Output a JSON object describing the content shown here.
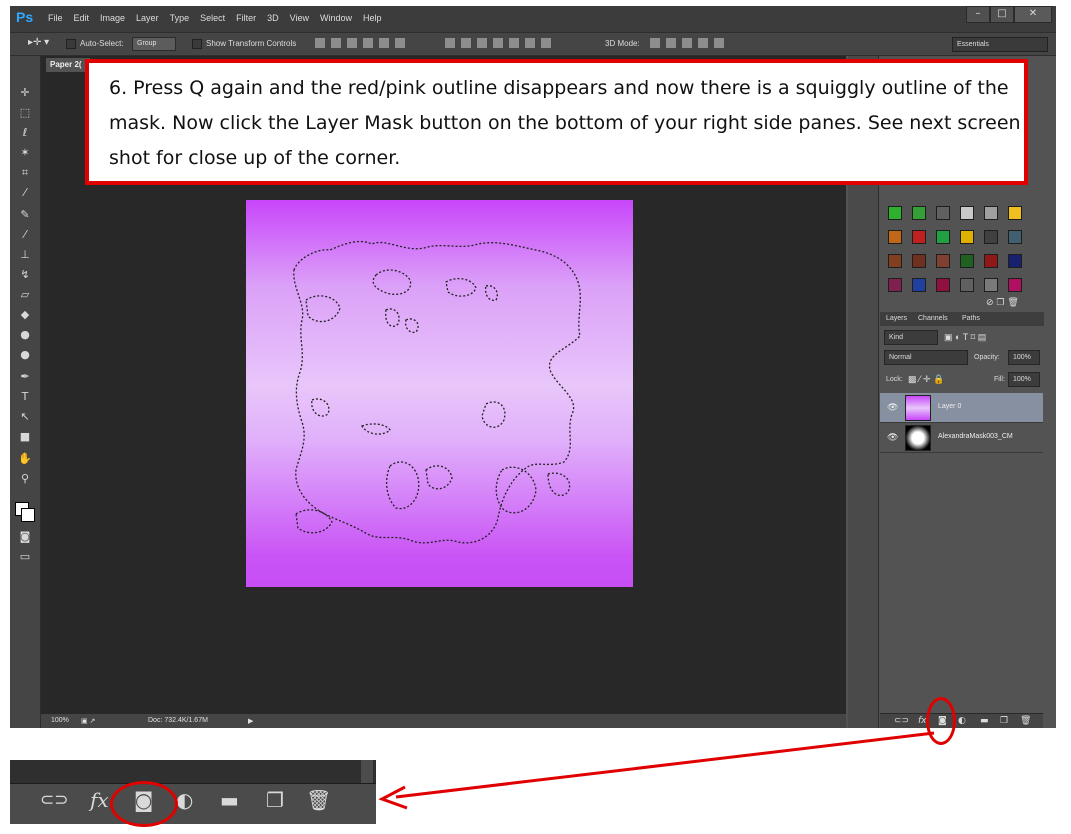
{
  "app": {
    "logo": "Ps",
    "menus": [
      "File",
      "Edit",
      "Image",
      "Layer",
      "Type",
      "Select",
      "Filter",
      "3D",
      "View",
      "Window",
      "Help"
    ],
    "window_buttons": [
      "–",
      "□",
      "✕"
    ]
  },
  "options_bar": {
    "auto_select_label": "Auto-Select:",
    "auto_select_value": "Group",
    "show_transform_label": "Show Transform Controls",
    "mode_3d_label": "3D Mode:",
    "workspace": "Essentials"
  },
  "document": {
    "tab_label": "Paper 2(",
    "zoom": "100%",
    "doc_size": "Doc: 732.4K/1.67M"
  },
  "layers_panel": {
    "tabs": [
      "Layers",
      "Channels",
      "Paths"
    ],
    "filter_kind": "Kind",
    "blend_mode": "Normal",
    "opacity_label": "Opacity:",
    "opacity_value": "100%",
    "lock_label": "Lock:",
    "fill_label": "Fill:",
    "fill_value": "100%",
    "layers": [
      {
        "name": "Layer 0",
        "selected": true
      },
      {
        "name": "AlexandraMask003_CM",
        "selected": false
      }
    ]
  },
  "instruction": {
    "text": "6.  Press Q again and the red/pink outline disappears and now there is a squiggly outline of the mask.  Now click the Layer Mask button on the bottom of your right side panes.  See next screen shot for close up of the corner."
  },
  "colors": {
    "highlight": "#e00000",
    "canvas_top": "#c846fa",
    "canvas_mid": "#e8c6fa",
    "panel_bg": "#535353",
    "selected_layer": "#8690a0"
  },
  "zoom_icons": [
    "link-icon",
    "fx-icon",
    "layer-mask-icon",
    "adjustment-icon",
    "folder-icon",
    "new-layer-icon",
    "trash-icon"
  ]
}
